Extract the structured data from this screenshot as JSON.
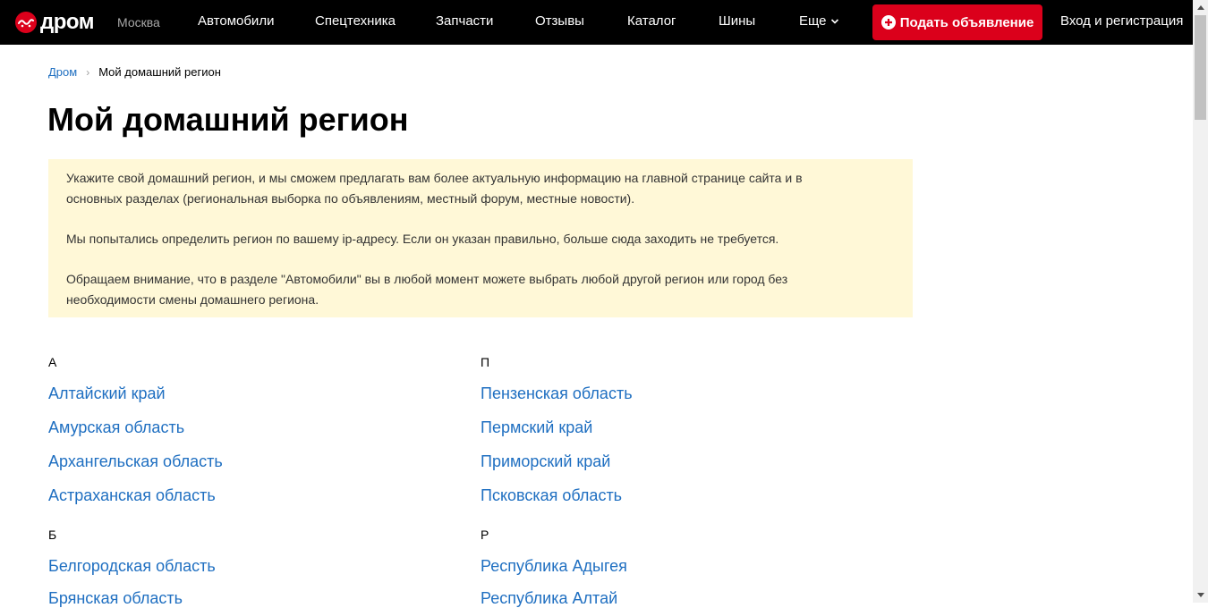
{
  "header": {
    "logo_text": "дром",
    "city": "Москва",
    "nav": [
      "Автомобили",
      "Спецтехника",
      "Запчасти",
      "Отзывы",
      "Каталог",
      "Шины",
      "Еще"
    ],
    "post_button": "Подать объявление",
    "login": "Вход и регистрация",
    "accent_color": "#db001b"
  },
  "breadcrumb": {
    "home": "Дром",
    "separator": "›",
    "current": "Мой домашний регион"
  },
  "page_title": "Мой домашний регион",
  "notice": {
    "paragraphs": [
      "Укажите свой домашний регион, и мы сможем предлагать вам более актуальную информацию на главной странице сайта и в основных разделах (региональная выборка по объявлениям, местный форум, местные новости).",
      "Мы попытались определить регион по вашему ip-адресу. Если он указан правильно, больше сюда заходить не требуется.",
      "Обращаем внимание, что в разделе \"Автомобили\" вы в любой момент можете выбрать любой другой регион или город без необходимости смены домашнего региона."
    ],
    "background_color": "#fff8d7"
  },
  "regions": {
    "left": [
      {
        "letter": "А",
        "items": [
          "Алтайский край",
          "Амурская область",
          "Архангельская область",
          "Астраханская область"
        ]
      },
      {
        "letter": "Б",
        "items": [
          "Белгородская область",
          "Брянская область"
        ]
      }
    ],
    "right": [
      {
        "letter": "П",
        "items": [
          "Пензенская область",
          "Пермский край",
          "Приморский край",
          "Псковская область"
        ]
      },
      {
        "letter": "Р",
        "items": [
          "Республика Адыгея",
          "Республика Алтай"
        ]
      }
    ],
    "link_color": "#1f6fc1"
  }
}
